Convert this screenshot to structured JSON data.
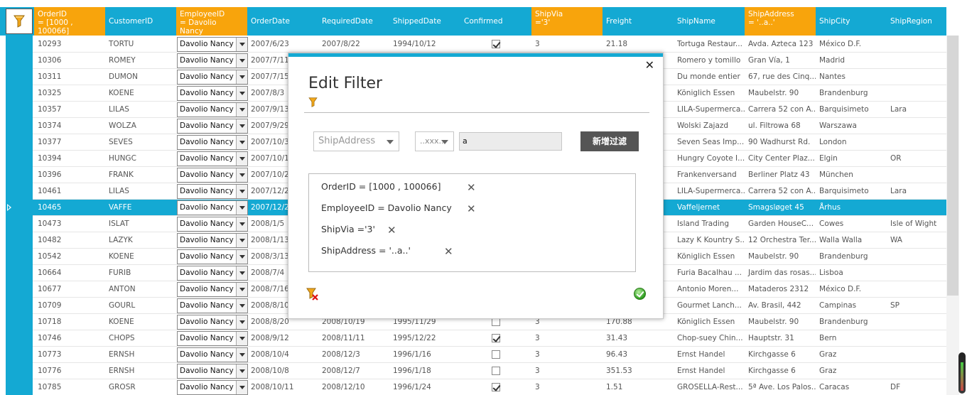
{
  "colors": {
    "header_bg": "#14a9d3",
    "filtered_header_bg": "#f8a40c",
    "selected_row_bg": "#14a9d3",
    "dialog_accent": "#14a9d3",
    "add_button_bg": "#555555"
  },
  "icons": {
    "filter": "funnel-icon",
    "clear": "clear-filter-icon",
    "confirm": "check-circle-icon",
    "close": "close-icon",
    "remove": "remove-icon"
  },
  "columns": [
    {
      "key": "OrderID",
      "label": "OrderID\n= [1000 , 100066]",
      "filtered": true
    },
    {
      "key": "CustomerID",
      "label": "CustomerID",
      "filtered": false
    },
    {
      "key": "EmployeeID",
      "label": "EmployeeID\n= Davolio\nNancy",
      "filtered": true
    },
    {
      "key": "OrderDate",
      "label": "OrderDate",
      "filtered": false
    },
    {
      "key": "RequiredDate",
      "label": "RequiredDate",
      "filtered": false
    },
    {
      "key": "ShippedDate",
      "label": "ShippedDate",
      "filtered": false
    },
    {
      "key": "Confirmed",
      "label": "Confirmed",
      "filtered": false
    },
    {
      "key": "ShipVia",
      "label": "ShipVia\n='3'",
      "filtered": true
    },
    {
      "key": "Freight",
      "label": "Freight",
      "filtered": false
    },
    {
      "key": "ShipName",
      "label": "ShipName",
      "filtered": false
    },
    {
      "key": "ShipAddress",
      "label": "ShipAddress\n= '..a..'",
      "filtered": true
    },
    {
      "key": "ShipCity",
      "label": "ShipCity",
      "filtered": false
    },
    {
      "key": "ShipRegion",
      "label": "ShipRegion",
      "filtered": false
    }
  ],
  "rows": [
    {
      "OrderID": "10293",
      "CustomerID": "TORTU",
      "EmployeeID": "Davolio Nancy",
      "OrderDate": "2007/6/23",
      "RequiredDate": "2007/8/22",
      "ShippedDate": "1994/10/12",
      "Confirmed": true,
      "ShipVia": "3",
      "Freight": "21.18",
      "ShipName": "Tortuga Restaur...",
      "ShipAddress": "Avda. Azteca 123",
      "ShipCity": "México D.F.",
      "ShipRegion": ""
    },
    {
      "OrderID": "10306",
      "CustomerID": "ROMEY",
      "EmployeeID": "Davolio Nancy",
      "OrderDate": "2007/7/11",
      "RequiredDate": "",
      "ShippedDate": "",
      "Confirmed": null,
      "ShipVia": "",
      "Freight": "",
      "ShipName": "Romero y tomillo",
      "ShipAddress": "Gran Vía, 1",
      "ShipCity": "Madrid",
      "ShipRegion": ""
    },
    {
      "OrderID": "10311",
      "CustomerID": "DUMON",
      "EmployeeID": "Davolio Nancy",
      "OrderDate": "2007/7/15",
      "RequiredDate": "",
      "ShippedDate": "",
      "Confirmed": null,
      "ShipVia": "",
      "Freight": "",
      "ShipName": "Du monde entier",
      "ShipAddress": "67, rue des Cinq...",
      "ShipCity": "Nantes",
      "ShipRegion": ""
    },
    {
      "OrderID": "10325",
      "CustomerID": "KOENE",
      "EmployeeID": "Davolio Nancy",
      "OrderDate": "2007/8/3",
      "RequiredDate": "",
      "ShippedDate": "",
      "Confirmed": null,
      "ShipVia": "",
      "Freight": "",
      "ShipName": "Königlich Essen",
      "ShipAddress": "Maubelstr. 90",
      "ShipCity": "Brandenburg",
      "ShipRegion": ""
    },
    {
      "OrderID": "10357",
      "CustomerID": "LILAS",
      "EmployeeID": "Davolio Nancy",
      "OrderDate": "2007/9/13",
      "RequiredDate": "",
      "ShippedDate": "",
      "Confirmed": null,
      "ShipVia": "",
      "Freight": "",
      "ShipName": "LILA-Supermerca...",
      "ShipAddress": "Carrera 52 con A...",
      "ShipCity": "Barquisimeto",
      "ShipRegion": "Lara"
    },
    {
      "OrderID": "10374",
      "CustomerID": "WOLZA",
      "EmployeeID": "Davolio Nancy",
      "OrderDate": "2007/9/29",
      "RequiredDate": "",
      "ShippedDate": "",
      "Confirmed": null,
      "ShipVia": "",
      "Freight": "",
      "ShipName": "Wolski Zajazd",
      "ShipAddress": "ul. Filtrowa 68",
      "ShipCity": "Warszawa",
      "ShipRegion": ""
    },
    {
      "OrderID": "10377",
      "CustomerID": "SEVES",
      "EmployeeID": "Davolio Nancy",
      "OrderDate": "2007/10/3",
      "RequiredDate": "",
      "ShippedDate": "",
      "Confirmed": null,
      "ShipVia": "",
      "Freight": "",
      "ShipName": "Seven Seas Imp...",
      "ShipAddress": "90 Wadhurst Rd.",
      "ShipCity": "London",
      "ShipRegion": ""
    },
    {
      "OrderID": "10394",
      "CustomerID": "HUNGC",
      "EmployeeID": "Davolio Nancy",
      "OrderDate": "2007/10/19",
      "RequiredDate": "",
      "ShippedDate": "",
      "Confirmed": null,
      "ShipVia": "",
      "Freight": "",
      "ShipName": "Hungry Coyote I...",
      "ShipAddress": "City Center Plaz...",
      "ShipCity": "Elgin",
      "ShipRegion": "OR"
    },
    {
      "OrderID": "10396",
      "CustomerID": "FRANK",
      "EmployeeID": "Davolio Nancy",
      "OrderDate": "2007/10/21",
      "RequiredDate": "",
      "ShippedDate": "",
      "Confirmed": null,
      "ShipVia": "",
      "Freight": "",
      "ShipName": "Frankenversand",
      "ShipAddress": "Berliner Platz 43",
      "ShipCity": "München",
      "ShipRegion": ""
    },
    {
      "OrderID": "10461",
      "CustomerID": "LILAS",
      "EmployeeID": "Davolio Nancy",
      "OrderDate": "2007/12/23",
      "RequiredDate": "",
      "ShippedDate": "",
      "Confirmed": null,
      "ShipVia": "",
      "Freight": "",
      "ShipName": "LILA-Supermerca...",
      "ShipAddress": "Carrera 52 con A...",
      "ShipCity": "Barquisimeto",
      "ShipRegion": "Lara"
    },
    {
      "OrderID": "10465",
      "CustomerID": "VAFFE",
      "EmployeeID": "Davolio Nancy",
      "OrderDate": "2007/12/28",
      "RequiredDate": "",
      "ShippedDate": "",
      "Confirmed": null,
      "ShipVia": "",
      "Freight": "",
      "ShipName": "Vaffeljernet",
      "ShipAddress": "Smagsløget 45",
      "ShipCity": "Århus",
      "ShipRegion": "",
      "selected": true
    },
    {
      "OrderID": "10473",
      "CustomerID": "ISLAT",
      "EmployeeID": "Davolio Nancy",
      "OrderDate": "2008/1/5",
      "RequiredDate": "",
      "ShippedDate": "",
      "Confirmed": null,
      "ShipVia": "",
      "Freight": "",
      "ShipName": "Island Trading",
      "ShipAddress": "Garden HouseC...",
      "ShipCity": "Cowes",
      "ShipRegion": "Isle of Wight"
    },
    {
      "OrderID": "10482",
      "CustomerID": "LAZYK",
      "EmployeeID": "Davolio Nancy",
      "OrderDate": "2008/1/13",
      "RequiredDate": "",
      "ShippedDate": "",
      "Confirmed": null,
      "ShipVia": "",
      "Freight": "",
      "ShipName": "Lazy K Kountry S...",
      "ShipAddress": "12 Orchestra Ter...",
      "ShipCity": "Walla Walla",
      "ShipRegion": "WA"
    },
    {
      "OrderID": "10542",
      "CustomerID": "KOENE",
      "EmployeeID": "Davolio Nancy",
      "OrderDate": "2008/3/13",
      "RequiredDate": "",
      "ShippedDate": "",
      "Confirmed": null,
      "ShipVia": "",
      "Freight": "",
      "ShipName": "Königlich Essen",
      "ShipAddress": "Maubelstr. 90",
      "ShipCity": "Brandenburg",
      "ShipRegion": ""
    },
    {
      "OrderID": "10664",
      "CustomerID": "FURIB",
      "EmployeeID": "Davolio Nancy",
      "OrderDate": "2008/7/4",
      "RequiredDate": "",
      "ShippedDate": "",
      "Confirmed": null,
      "ShipVia": "",
      "Freight": "",
      "ShipName": "Furia Bacalhau ...",
      "ShipAddress": "Jardim das rosas...",
      "ShipCity": "Lisboa",
      "ShipRegion": ""
    },
    {
      "OrderID": "10677",
      "CustomerID": "ANTON",
      "EmployeeID": "Davolio Nancy",
      "OrderDate": "2008/7/16",
      "RequiredDate": "",
      "ShippedDate": "",
      "Confirmed": null,
      "ShipVia": "",
      "Freight": "",
      "ShipName": "Antonio Moren...",
      "ShipAddress": "Mataderos  2312",
      "ShipCity": "México D.F.",
      "ShipRegion": ""
    },
    {
      "OrderID": "10709",
      "CustomerID": "GOURL",
      "EmployeeID": "Davolio Nancy",
      "OrderDate": "2008/8/10",
      "RequiredDate": "",
      "ShippedDate": "",
      "Confirmed": null,
      "ShipVia": "",
      "Freight": "",
      "ShipName": "Gourmet Lanch...",
      "ShipAddress": "Av. Brasil, 442",
      "ShipCity": "Campinas",
      "ShipRegion": "SP"
    },
    {
      "OrderID": "10718",
      "CustomerID": "KOENE",
      "EmployeeID": "Davolio Nancy",
      "OrderDate": "2008/8/20",
      "RequiredDate": "2008/10/19",
      "ShippedDate": "1995/11/29",
      "Confirmed": false,
      "ShipVia": "3",
      "Freight": "170.88",
      "ShipName": "Königlich Essen",
      "ShipAddress": "Maubelstr. 90",
      "ShipCity": "Brandenburg",
      "ShipRegion": ""
    },
    {
      "OrderID": "10746",
      "CustomerID": "CHOPS",
      "EmployeeID": "Davolio Nancy",
      "OrderDate": "2008/9/12",
      "RequiredDate": "2008/11/11",
      "ShippedDate": "1995/12/22",
      "Confirmed": true,
      "ShipVia": "3",
      "Freight": "31.43",
      "ShipName": "Chop-suey Chin...",
      "ShipAddress": "Hauptstr. 31",
      "ShipCity": "Bern",
      "ShipRegion": ""
    },
    {
      "OrderID": "10773",
      "CustomerID": "ERNSH",
      "EmployeeID": "Davolio Nancy",
      "OrderDate": "2008/10/4",
      "RequiredDate": "2008/12/3",
      "ShippedDate": "1996/1/16",
      "Confirmed": false,
      "ShipVia": "3",
      "Freight": "96.43",
      "ShipName": "Ernst Handel",
      "ShipAddress": "Kirchgasse 6",
      "ShipCity": "Graz",
      "ShipRegion": ""
    },
    {
      "OrderID": "10776",
      "CustomerID": "ERNSH",
      "EmployeeID": "Davolio Nancy",
      "OrderDate": "2008/10/8",
      "RequiredDate": "2008/12/7",
      "ShippedDate": "1996/1/18",
      "Confirmed": false,
      "ShipVia": "3",
      "Freight": "351.53",
      "ShipName": "Ernst Handel",
      "ShipAddress": "Kirchgasse 6",
      "ShipCity": "Graz",
      "ShipRegion": ""
    },
    {
      "OrderID": "10785",
      "CustomerID": "GROSR",
      "EmployeeID": "Davolio Nancy",
      "OrderDate": "2008/10/11",
      "RequiredDate": "2008/12/10",
      "ShippedDate": "1996/1/24",
      "Confirmed": true,
      "ShipVia": "3",
      "Freight": "1.51",
      "ShipName": "GROSELLA-Rest...",
      "ShipAddress": "5ª Ave. Los Palos...",
      "ShipCity": "Caracas",
      "ShipRegion": "DF"
    }
  ],
  "dialog": {
    "title": "Edit Filter",
    "field_select": "ShipAddress",
    "operator_select": "..xxx..",
    "value_input": "a",
    "add_button": "新增过滤",
    "filters": [
      {
        "text": "OrderID  = [1000 , 100066]"
      },
      {
        "text": "EmployeeID = Davolio Nancy"
      },
      {
        "text": "ShipVia ='3'"
      },
      {
        "text": "ShipAddress  = '..a..'"
      }
    ],
    "remove_label": "✕",
    "close_label": "✕"
  }
}
